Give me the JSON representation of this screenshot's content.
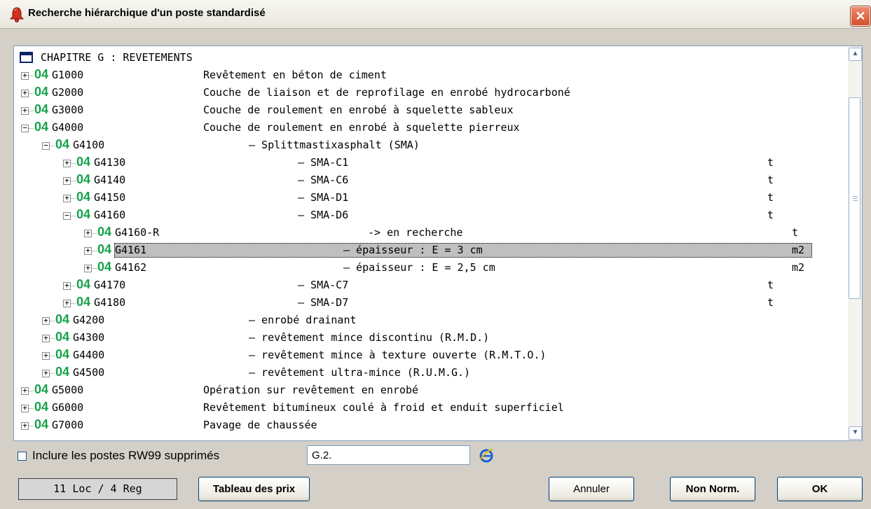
{
  "window": {
    "title": "Recherche hiérarchique d'un poste standardisé",
    "close_glyph": "✕"
  },
  "tree": {
    "badge": "04",
    "chapter": "CHAPITRE G : REVETEMENTS",
    "rows": [
      {
        "code": "G1000",
        "desc": "Revêtement en béton de ciment",
        "unit": "",
        "state": "collapsed"
      },
      {
        "code": "G2000",
        "desc": "Couche de liaison et de reprofilage en enrobé hydrocarboné",
        "unit": "",
        "state": "collapsed"
      },
      {
        "code": "G3000",
        "desc": "Couche de roulement en enrobé à squelette sableux",
        "unit": "",
        "state": "collapsed"
      },
      {
        "code": "G4000",
        "desc": "Couche de roulement en enrobé à squelette pierreux",
        "unit": "",
        "state": "expanded"
      },
      {
        "code": "G4100",
        "desc": "– Splittmastixasphalt (SMA)",
        "unit": "",
        "state": "expanded"
      },
      {
        "code": "G4130",
        "desc": "– SMA-C1",
        "unit": "t",
        "state": "collapsed"
      },
      {
        "code": "G4140",
        "desc": "– SMA-C6",
        "unit": "t",
        "state": "collapsed"
      },
      {
        "code": "G4150",
        "desc": "– SMA-D1",
        "unit": "t",
        "state": "collapsed"
      },
      {
        "code": "G4160",
        "desc": "– SMA-D6",
        "unit": "t",
        "state": "expanded"
      },
      {
        "code": "G4160-R",
        "desc": "-> en recherche",
        "unit": "t",
        "state": "collapsed"
      },
      {
        "code": "G4161",
        "desc": "– épaisseur : E = 3 cm",
        "unit": "m2",
        "state": "collapsed",
        "selected": true
      },
      {
        "code": "G4162",
        "desc": "– épaisseur : E = 2,5 cm",
        "unit": "m2",
        "state": "collapsed"
      },
      {
        "code": "G4170",
        "desc": "– SMA-C7",
        "unit": "t",
        "state": "collapsed"
      },
      {
        "code": "G4180",
        "desc": "– SMA-D7",
        "unit": "t",
        "state": "collapsed"
      },
      {
        "code": "G4200",
        "desc": "– enrobé drainant",
        "unit": "",
        "state": "collapsed"
      },
      {
        "code": "G4300",
        "desc": "– revêtement mince discontinu (R.M.D.)",
        "unit": "",
        "state": "collapsed"
      },
      {
        "code": "G4400",
        "desc": "– revêtement mince à texture ouverte (R.M.T.O.)",
        "unit": "",
        "state": "collapsed"
      },
      {
        "code": "G4500",
        "desc": "– revêtement ultra-mince (R.U.M.G.)",
        "unit": "",
        "state": "collapsed"
      },
      {
        "code": "G5000",
        "desc": "Opération sur revêtement en enrobé",
        "unit": "",
        "state": "collapsed"
      },
      {
        "code": "G6000",
        "desc": "Revêtement bitumineux coulé à froid et enduit superficiel",
        "unit": "",
        "state": "collapsed"
      },
      {
        "code": "G7000",
        "desc": "Pavage de chaussée",
        "unit": "",
        "state": "collapsed"
      }
    ]
  },
  "scrollbar": {
    "up_glyph": "▲",
    "down_glyph": "▼"
  },
  "filter": {
    "include_deleted_label": "Inclure les postes RW99 supprimés",
    "include_deleted_checked": false,
    "search_value": "G.2."
  },
  "status": {
    "text": "11 Loc / 4 Reg"
  },
  "buttons": {
    "price_table": "Tableau des prix",
    "cancel": "Annuler",
    "non_norm": "Non Norm.",
    "ok": "OK"
  }
}
